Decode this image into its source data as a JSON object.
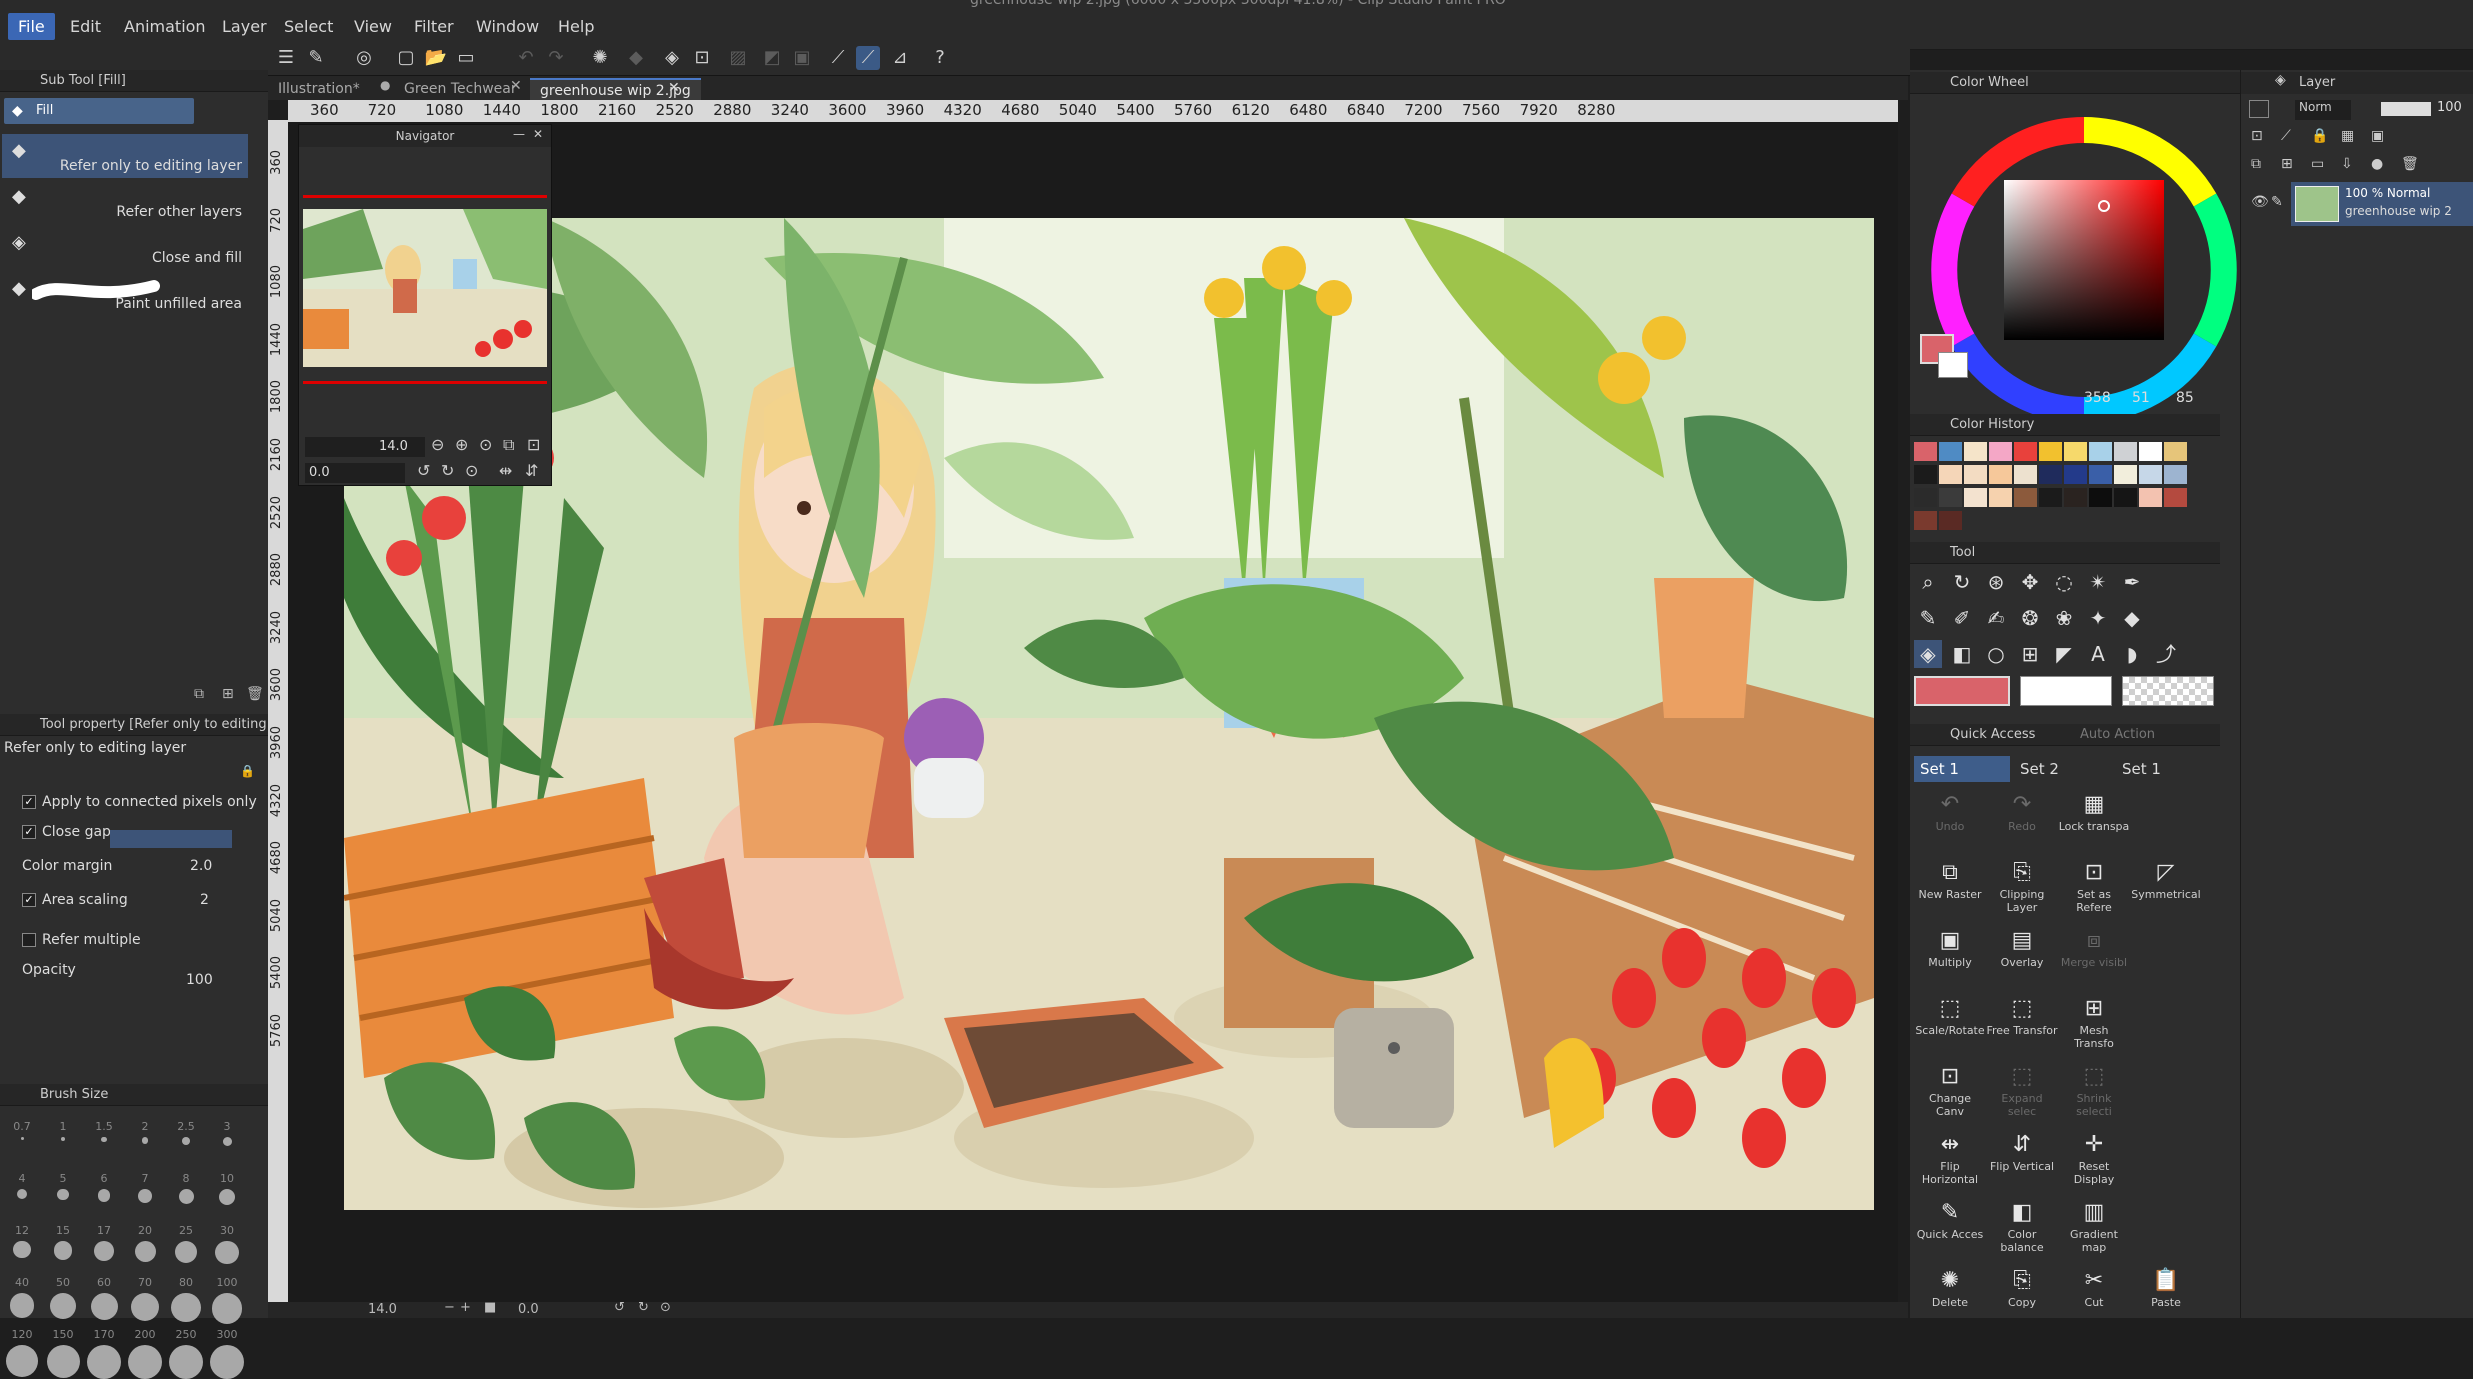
{
  "window": {
    "title": "greenhouse wip 2.jpg (6000 x 3500px 300dpi 41.8%) - Clip Studio Paint PRO"
  },
  "menu": {
    "items": [
      "File",
      "Edit",
      "Animation",
      "Layer",
      "Select",
      "View",
      "Filter",
      "Window",
      "Help"
    ]
  },
  "tabs": [
    {
      "label": "Illustration*"
    },
    {
      "label": "Green Techwear"
    },
    {
      "label": "greenhouse wip 2.jpg"
    }
  ],
  "ruler": {
    "h_ticks": [
      "360",
      "720",
      "1080",
      "1440",
      "1800",
      "2160",
      "2520",
      "2880",
      "3240",
      "3600",
      "3960",
      "4320",
      "4680",
      "5040",
      "5400",
      "5760",
      "6120",
      "6480",
      "6840",
      "7200",
      "7560",
      "7920",
      "8280"
    ],
    "v_ticks": [
      "360",
      "720",
      "1080",
      "1440",
      "1800",
      "2160",
      "2520",
      "2880",
      "3240",
      "3600",
      "3960",
      "4320",
      "4680",
      "5040",
      "5400",
      "5760"
    ]
  },
  "subtool": {
    "header": "Sub Tool [Fill]",
    "tab": "Fill",
    "items": [
      "Refer only to editing layer",
      "Refer other layers",
      "Close and fill",
      "Paint unfilled area"
    ]
  },
  "toolprop": {
    "header": "Tool property [Refer only to editing",
    "name": "Refer only to editing layer",
    "apply_connected": "Apply to connected pixels only",
    "close_gap": "Close gap",
    "color_margin_label": "Color margin",
    "color_margin_value": "2.0",
    "area_scaling_label": "Area scaling",
    "area_scaling_value": "2",
    "refer_multiple": "Refer multiple",
    "opacity_label": "Opacity",
    "opacity_value": "100"
  },
  "brushsize": {
    "header": "Brush Size",
    "sizes": [
      "0.7",
      "1",
      "1.5",
      "2",
      "2.5",
      "3",
      "4",
      "5",
      "6",
      "7",
      "8",
      "10",
      "12",
      "15",
      "17",
      "20",
      "25",
      "30",
      "40",
      "50",
      "60",
      "70",
      "80",
      "100",
      "120",
      "150",
      "170",
      "200",
      "250",
      "300"
    ]
  },
  "navigator": {
    "title": "Navigator",
    "zoom": "14.0",
    "angle": "0.0"
  },
  "bottom": {
    "zoom": "14.0",
    "angle": "0.0"
  },
  "colorwheel": {
    "header": "Color Wheel",
    "h": "358",
    "s": "51",
    "v": "85",
    "main_color": "#d9636a"
  },
  "colorhistory": {
    "header": "Color History",
    "swatches": [
      "#d9636a",
      "#4f8bc4",
      "#f5e4c9",
      "#f4a7c6",
      "#e8413c",
      "#f2c12e",
      "#f6d96b",
      "#a8d1e9",
      "#cfd1d4",
      "#ffffff",
      "#e6c57a",
      "#1b1b1b",
      "#f5d6b8",
      "#f3dcc2",
      "#f6c89a",
      "#ede1cf",
      "#1f2b5c",
      "#233a8a",
      "#3a5fa8",
      "#f2eedc",
      "#c6d7e8",
      "#9db4d0",
      "#2b2b2b",
      "#3b3b3b",
      "#f3e2cf",
      "#f6d2ae",
      "#8c5a3c",
      "#1b1b1b",
      "#2a2320",
      "#0d0d0d",
      "#151515",
      "#f3c2b0",
      "#b44a3f",
      "#7a3a2e",
      "#5a2a24"
    ]
  },
  "tool": {
    "header": "Tool",
    "main_color": "#d9636a",
    "sub_color": "#ffffff"
  },
  "quickaccess": {
    "header": "Quick Access",
    "auto_action": "Auto Action",
    "sets": [
      "Set 1",
      "Set 2",
      "Set 1"
    ],
    "items": [
      {
        "label": "Undo",
        "icon": "undo-icon",
        "glyph": "↶",
        "dim": true
      },
      {
        "label": "Redo",
        "icon": "redo-icon",
        "glyph": "↷",
        "dim": true
      },
      {
        "label": "Lock transpa",
        "icon": "lock-transparent-icon",
        "glyph": "▦",
        "dim": false
      },
      {
        "label": "",
        "icon": "",
        "glyph": "",
        "dim": false
      },
      {
        "label": "New Raster",
        "icon": "new-raster-icon",
        "glyph": "⧉",
        "dim": false
      },
      {
        "label": "Clipping Layer",
        "icon": "clipping-layer-icon",
        "glyph": "⎘",
        "dim": false
      },
      {
        "label": "Set as Refere",
        "icon": "set-reference-icon",
        "glyph": "⊡",
        "dim": false
      },
      {
        "label": "Symmetrical",
        "icon": "symmetrical-icon",
        "glyph": "◸",
        "dim": false
      },
      {
        "label": "Multiply",
        "icon": "multiply-icon",
        "glyph": "▣",
        "dim": false
      },
      {
        "label": "Overlay",
        "icon": "overlay-icon",
        "glyph": "▤",
        "dim": false
      },
      {
        "label": "Merge visibl",
        "icon": "merge-visible-icon",
        "glyph": "⧈",
        "dim": true
      },
      {
        "label": "",
        "icon": "",
        "glyph": "",
        "dim": false
      },
      {
        "label": "Scale/Rotate",
        "icon": "scale-rotate-icon",
        "glyph": "⬚",
        "dim": false
      },
      {
        "label": "Free Transfor",
        "icon": "free-transform-icon",
        "glyph": "⬚",
        "dim": false
      },
      {
        "label": "Mesh Transfo",
        "icon": "mesh-transform-icon",
        "glyph": "⊞",
        "dim": false
      },
      {
        "label": "",
        "icon": "",
        "glyph": "",
        "dim": false
      },
      {
        "label": "Change Canv",
        "icon": "change-canvas-icon",
        "glyph": "⊡",
        "dim": false
      },
      {
        "label": "Expand selec",
        "icon": "expand-selection-icon",
        "glyph": "⬚",
        "dim": true
      },
      {
        "label": "Shrink selecti",
        "icon": "shrink-selection-icon",
        "glyph": "⬚",
        "dim": true
      },
      {
        "label": "",
        "icon": "",
        "glyph": "",
        "dim": false
      },
      {
        "label": "Flip Horizontal",
        "icon": "flip-horizontal-icon",
        "glyph": "⇹",
        "dim": false
      },
      {
        "label": "Flip Vertical",
        "icon": "flip-vertical-icon",
        "glyph": "⇵",
        "dim": false
      },
      {
        "label": "Reset Display",
        "icon": "reset-display-icon",
        "glyph": "✛",
        "dim": false
      },
      {
        "label": "",
        "icon": "",
        "glyph": "",
        "dim": false
      },
      {
        "label": "Quick Acces",
        "icon": "quick-access-icon",
        "glyph": "✎",
        "dim": false
      },
      {
        "label": "Color balance",
        "icon": "color-balance-icon",
        "glyph": "◧",
        "dim": false
      },
      {
        "label": "Gradient map",
        "icon": "gradient-map-icon",
        "glyph": "▥",
        "dim": false
      },
      {
        "label": "",
        "icon": "",
        "glyph": "",
        "dim": false
      },
      {
        "label": "Delete",
        "icon": "delete-icon",
        "glyph": "✺",
        "dim": false
      },
      {
        "label": "Copy",
        "icon": "copy-icon",
        "glyph": "⎘",
        "dim": false
      },
      {
        "label": "Cut",
        "icon": "cut-icon",
        "glyph": "✂",
        "dim": false
      },
      {
        "label": "Paste",
        "icon": "paste-icon",
        "glyph": "📋",
        "dim": false
      }
    ]
  },
  "layer": {
    "header": "Layer",
    "blend": "Norm",
    "opacity": "100",
    "row_opacity": "100 % Normal",
    "row_name": "greenhouse wip 2"
  }
}
